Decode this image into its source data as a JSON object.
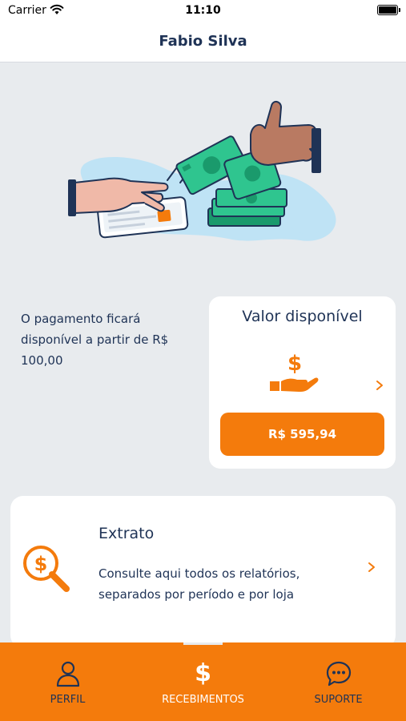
{
  "status": {
    "carrier": "Carrier",
    "time": "11:10"
  },
  "nav": {
    "title": "Fabio Silva"
  },
  "info": {
    "text": "O pagamento ficará disponível a partir de R$ 100,00"
  },
  "valor": {
    "title": "Valor disponível",
    "amount": "R$ 595,94"
  },
  "extrato": {
    "title": "Extrato",
    "description": "Consulte aqui todos os relatórios, separados por período e por loja"
  },
  "tabs": [
    {
      "label": "PERFIL",
      "icon": "person-icon"
    },
    {
      "label": "RECEBIMENTOS",
      "icon": "dollar-icon"
    },
    {
      "label": "SUPORTE",
      "icon": "chat-icon"
    }
  ],
  "colors": {
    "accent": "#f47b0c",
    "navy": "#1f3356",
    "background": "#e8ebee",
    "money_green": "#2fc58f"
  },
  "icons": {
    "money": "$"
  }
}
